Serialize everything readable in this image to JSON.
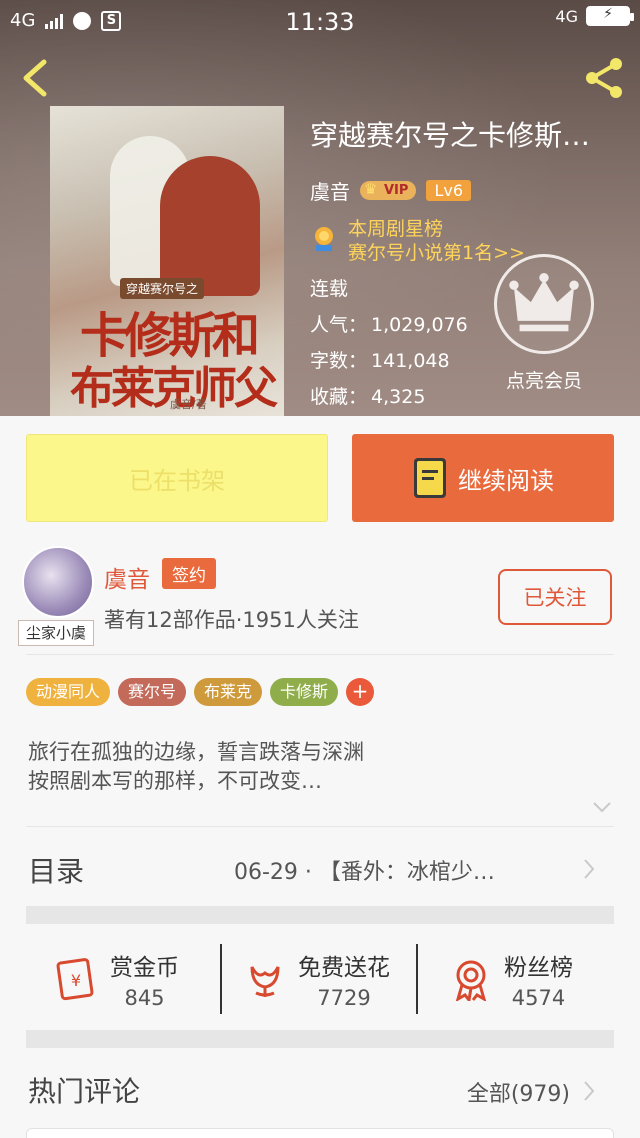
{
  "status_bar": {
    "network": "4G",
    "sim_icon_text": "S",
    "time": "11:33",
    "right_network": "4G",
    "icons": [
      "signal-icon",
      "globe-icon",
      "sim-icon",
      "battery-charging-icon"
    ]
  },
  "header": {
    "back_icon": "chevron-left-icon",
    "share_icon": "share-icon"
  },
  "book": {
    "cover_subtitle": "穿越赛尔号之",
    "cover_title_line1": "卡修斯和",
    "cover_title_line2": "布莱克师父",
    "cover_author": "虞音/著",
    "title": "穿越赛尔号之卡修斯…",
    "author": "虞音",
    "vip_badge": "VIP",
    "level": "Lv6",
    "rank_line1": "本周剧星榜",
    "rank_line2": "赛尔号小说第1名>>",
    "status": "连载",
    "popularity_label": "人气：",
    "popularity": "1,029,076",
    "wordcount_label": "字数：",
    "wordcount": "141,048",
    "favorites_label": "收藏：",
    "favorites": "4,325",
    "member_label": "点亮会员"
  },
  "actions": {
    "shelf_label": "已在书架",
    "read_label": "继续阅读"
  },
  "author_card": {
    "avatar_tag": "尘家小虞",
    "name": "虞音",
    "signed_badge": "签约",
    "description": "著有12部作品·1951人关注",
    "follow_label": "已关注"
  },
  "tags": [
    {
      "label": "动漫同人",
      "color": "#f0b23e"
    },
    {
      "label": "赛尔号",
      "color": "#c36a5b"
    },
    {
      "label": "布莱克",
      "color": "#cf9a3b"
    },
    {
      "label": "卡修斯",
      "color": "#8fae4b"
    }
  ],
  "tag_add": "+",
  "intro": {
    "line1": "旅行在孤独的边缘，誓言跌落与深渊",
    "line2": "按照剧本写的那样，不可改变…"
  },
  "toc": {
    "label": "目录",
    "latest": "06-29 · 【番外：冰棺少…"
  },
  "rewards": [
    {
      "name": "赏金币",
      "value": "845",
      "icon": "coin-envelope-icon"
    },
    {
      "name": "免费送花",
      "value": "7729",
      "icon": "flower-icon"
    },
    {
      "name": "粉丝榜",
      "value": "4574",
      "icon": "medal-icon"
    }
  ],
  "comments": {
    "title": "热门评论",
    "all_label": "全部(979)"
  },
  "colors": {
    "accent": "#e96a3d",
    "shelf_bg": "#fcf78a",
    "rank_text": "#ffd45a"
  }
}
